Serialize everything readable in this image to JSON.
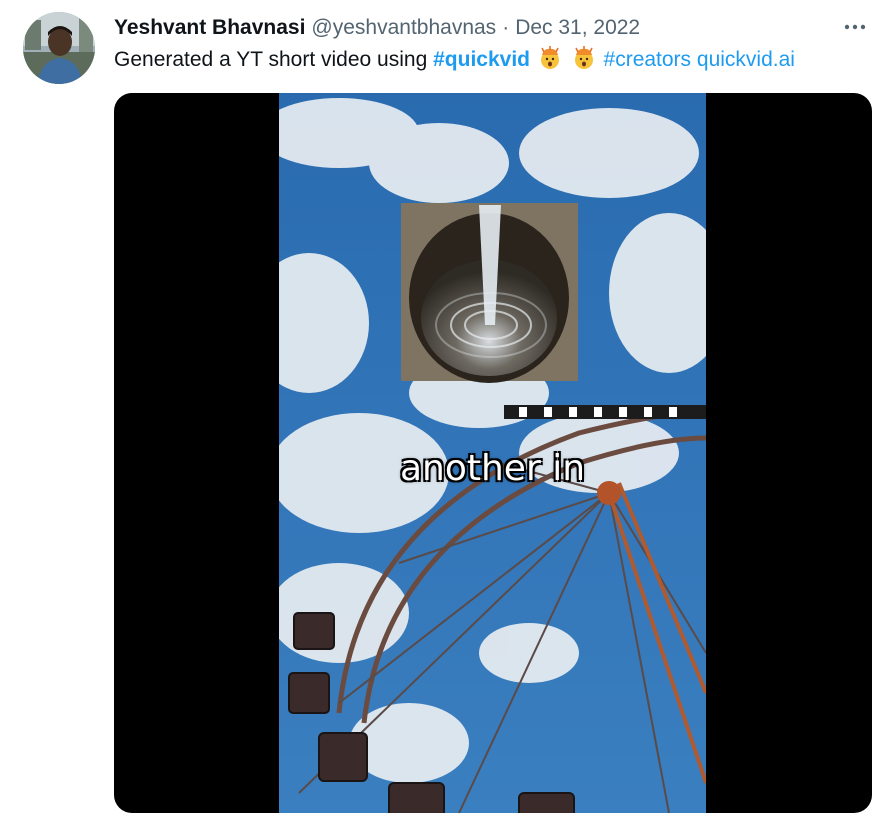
{
  "tweet": {
    "author_name": "Yeshvant Bhavnasi",
    "author_handle": "@yeshvantbhavnas",
    "separator": "·",
    "date": "Dec 31, 2022",
    "text_prefix": "Generated a YT short video using",
    "hashtag_1": "#quickvid",
    "emoji_1": "exploding-head-emoji",
    "emoji_2": "exploding-head-emoji",
    "hashtag_2": "#creators",
    "link": "quickvid.ai"
  },
  "video": {
    "caption": "another in"
  },
  "colors": {
    "link_blue": "#1d9bf0",
    "secondary_text": "#536471",
    "sky_blue": "#2f6fb0",
    "media_background": "#000000"
  },
  "icons": [
    "more-options-icon",
    "exploding-head-emoji"
  ]
}
